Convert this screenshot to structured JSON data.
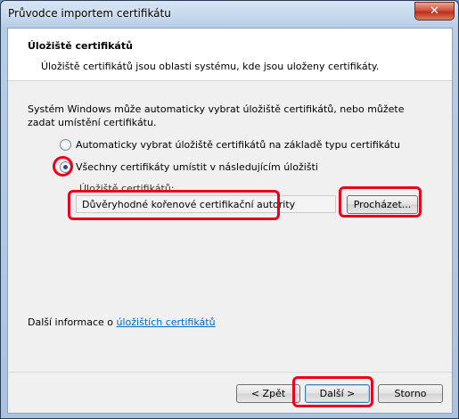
{
  "window": {
    "title": "Průvodce importem certifikátu",
    "close_glyph": "✕"
  },
  "header": {
    "title": "Úložiště certifikátů",
    "description": "Úložiště certifikátů jsou oblasti systému, kde jsou uloženy certifikáty."
  },
  "body": {
    "intro": "Systém Windows může automaticky vybrat úložiště certifikátů, nebo můžete zadat umístění certifikátu.",
    "options": [
      {
        "label": "Automaticky vybrat úložiště certifikátů na základě typu certifikátu",
        "selected": false
      },
      {
        "label": "Všechny certifikáty umístit v následujícím úložišti",
        "selected": true
      }
    ],
    "store_label": "Úložiště certifikátů:",
    "store_value": "Důvěryhodné kořenové certifikační autority",
    "browse_label": "Procházet..."
  },
  "footer": {
    "more_info_prefix": "Další informace o ",
    "more_info_link": "úložištích certifikátů",
    "back_label": "< Zpět",
    "next_label": "Další >",
    "cancel_label": "Storno"
  },
  "colors": {
    "highlight": "#e8001c",
    "link": "#0066cc"
  }
}
